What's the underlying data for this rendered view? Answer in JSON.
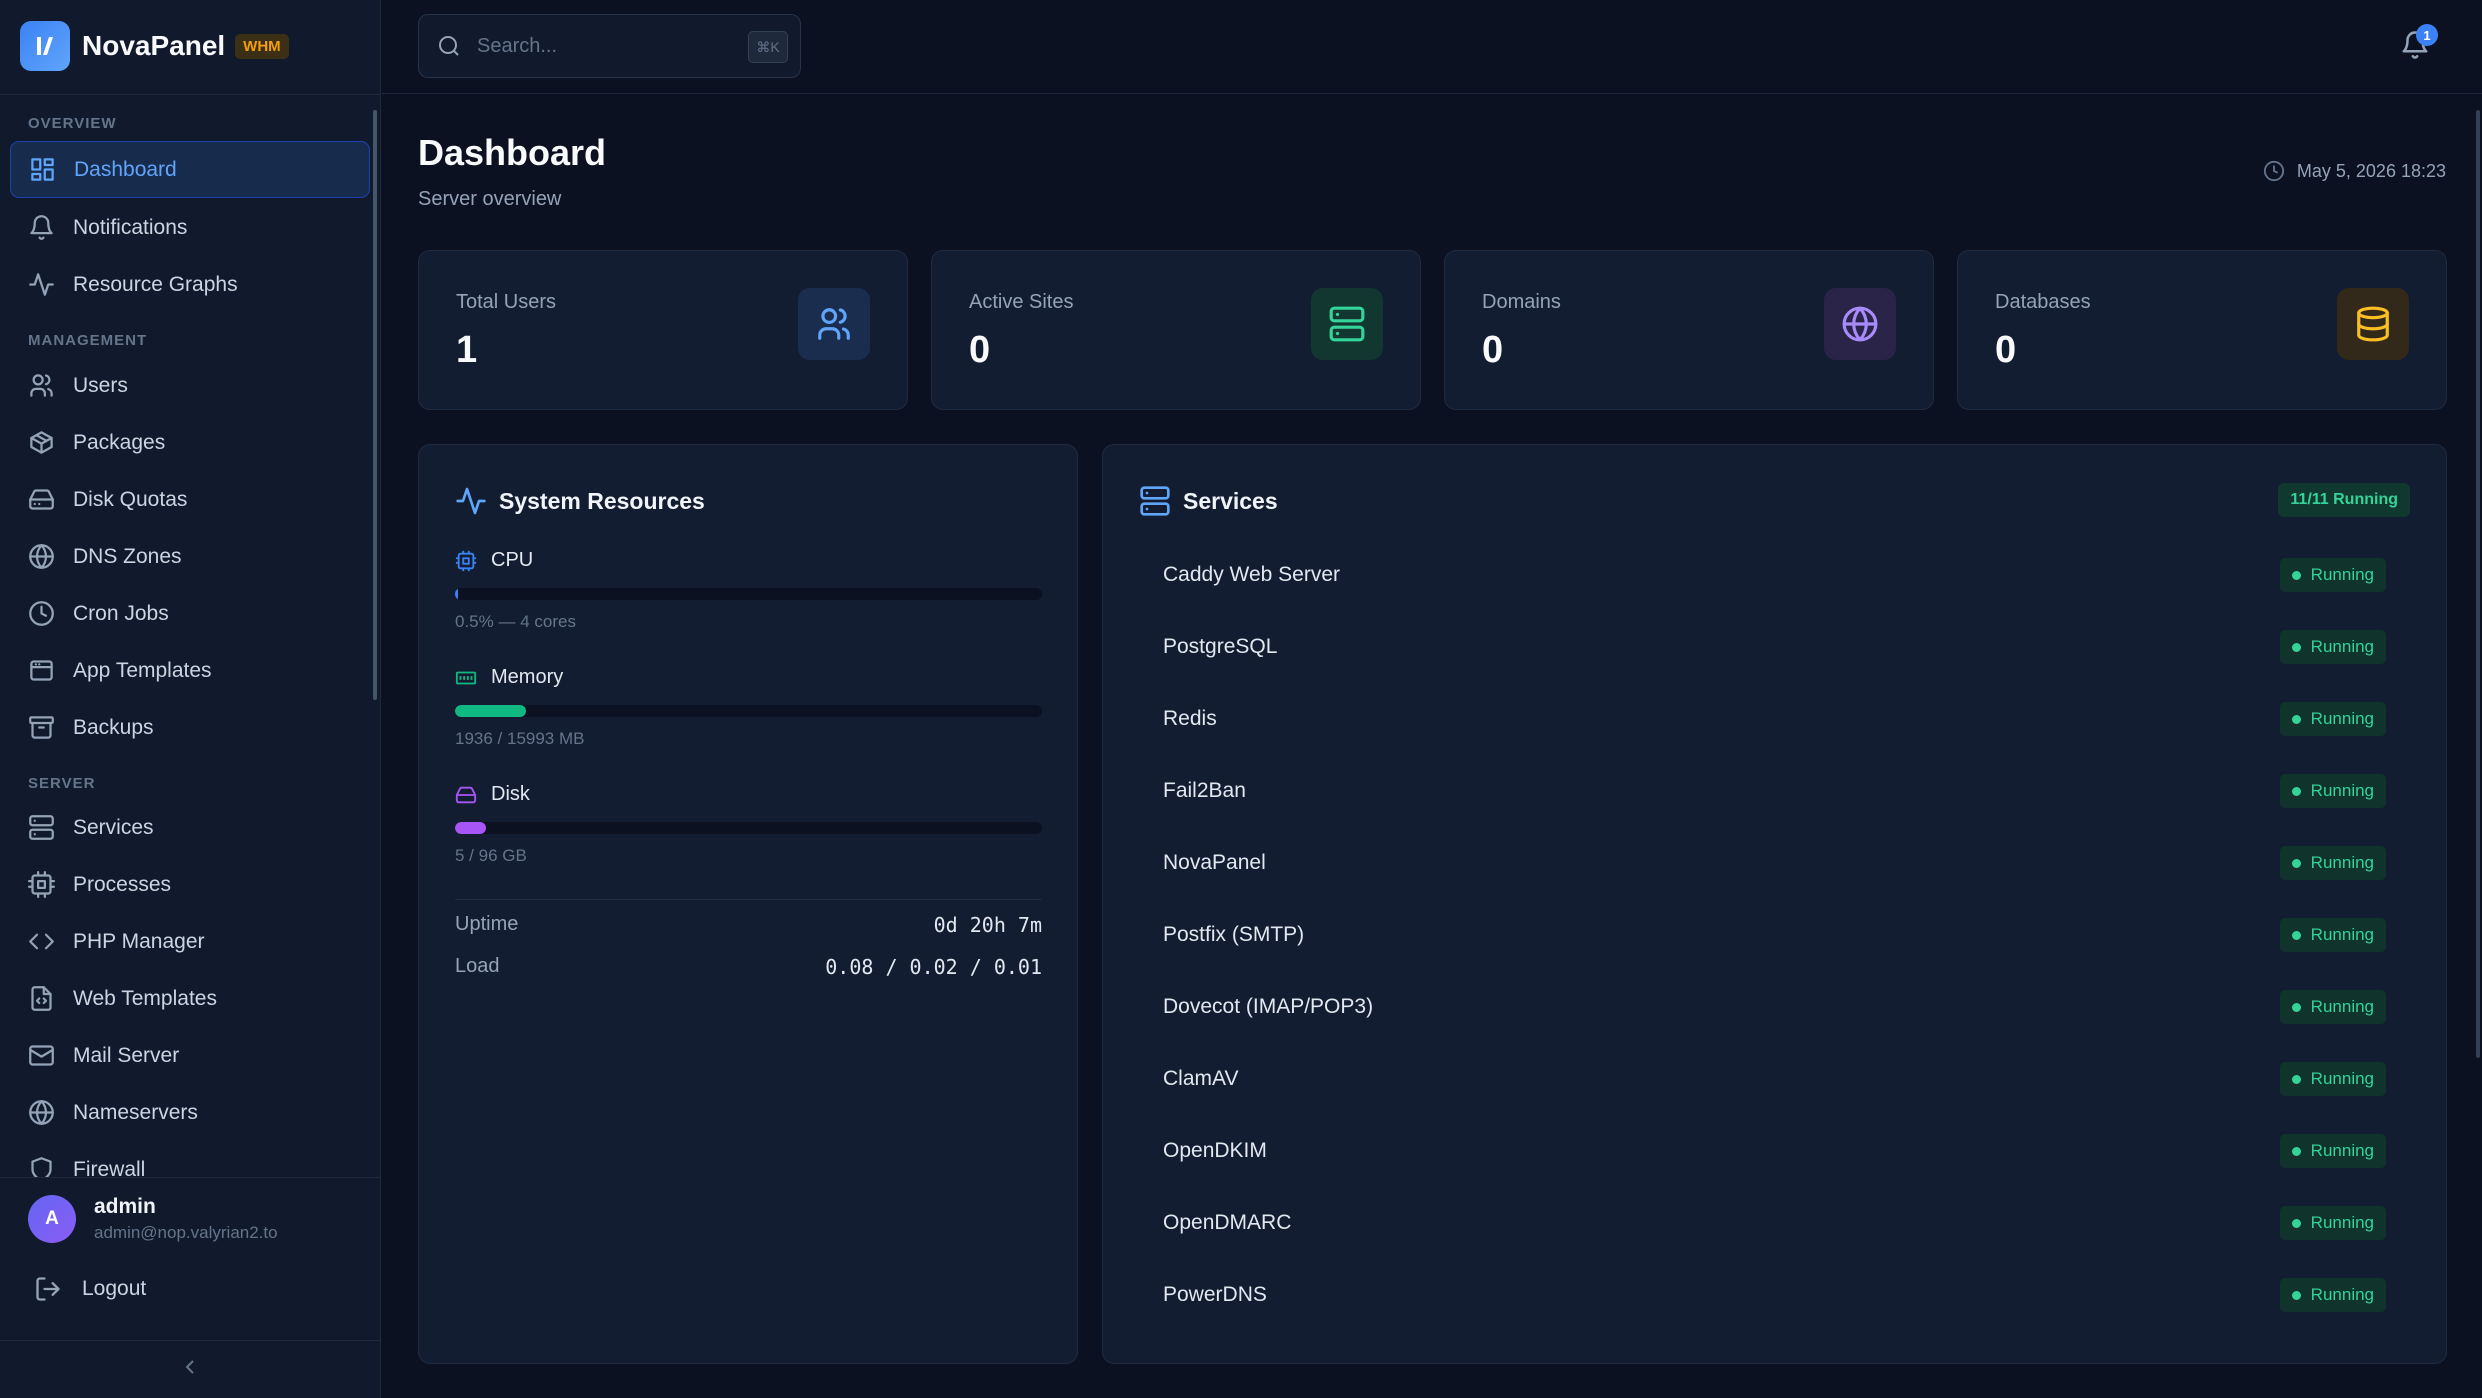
{
  "brand": {
    "name": "NovaPanel",
    "badge": "WHM"
  },
  "search": {
    "placeholder": "Search...",
    "shortcut": "⌘K"
  },
  "notifications": {
    "count": "1"
  },
  "sidebar": {
    "sections": {
      "overview": "OVERVIEW",
      "management": "MANAGEMENT",
      "server": "SERVER"
    },
    "items": [
      {
        "label": "Dashboard",
        "icon": "grid-icon",
        "active": true
      },
      {
        "label": "Notifications",
        "icon": "bell-icon"
      },
      {
        "label": "Resource Graphs",
        "icon": "activity-icon"
      },
      {
        "label": "Users",
        "icon": "users-icon"
      },
      {
        "label": "Packages",
        "icon": "package-icon"
      },
      {
        "label": "Disk Quotas",
        "icon": "hard-drive-icon"
      },
      {
        "label": "DNS Zones",
        "icon": "globe-icon"
      },
      {
        "label": "Cron Jobs",
        "icon": "clock-icon"
      },
      {
        "label": "App Templates",
        "icon": "window-icon"
      },
      {
        "label": "Backups",
        "icon": "archive-icon"
      },
      {
        "label": "Services",
        "icon": "server-icon"
      },
      {
        "label": "Processes",
        "icon": "cpu-icon"
      },
      {
        "label": "PHP Manager",
        "icon": "code-icon"
      },
      {
        "label": "Web Templates",
        "icon": "file-code-icon"
      },
      {
        "label": "Mail Server",
        "icon": "mail-icon"
      },
      {
        "label": "Nameservers",
        "icon": "globe-icon"
      },
      {
        "label": "Firewall",
        "icon": "shield-icon"
      }
    ],
    "user": {
      "initial": "A",
      "name": "admin",
      "email": "admin@nop.valyrian2.to"
    },
    "logout": "Logout"
  },
  "page": {
    "title": "Dashboard",
    "subtitle": "Server overview",
    "timestamp": "May 5, 2026 18:23"
  },
  "stats": [
    {
      "label": "Total Users",
      "value": "1",
      "icon": "users-icon",
      "color": "#60a5fa"
    },
    {
      "label": "Active Sites",
      "value": "0",
      "icon": "server-icon",
      "color": "#34d399"
    },
    {
      "label": "Domains",
      "value": "0",
      "icon": "globe-icon",
      "color": "#a78bfa"
    },
    {
      "label": "Databases",
      "value": "0",
      "icon": "database-icon",
      "color": "#fbbf24"
    }
  ],
  "resources": {
    "title": "System Resources",
    "cpu": {
      "label": "CPU",
      "detail": "0.5% — 4 cores",
      "percent": 0.5,
      "color": "#3b82f6"
    },
    "memory": {
      "label": "Memory",
      "detail": "1936 / 15993 MB",
      "percent": 12.1,
      "color": "#10b981"
    },
    "disk": {
      "label": "Disk",
      "detail": "5 / 96 GB",
      "percent": 5.2,
      "color": "#a855f7"
    },
    "uptime": {
      "label": "Uptime",
      "value": "0d 20h 7m"
    },
    "load": {
      "label": "Load",
      "value": "0.08 / 0.02 / 0.01"
    }
  },
  "services": {
    "title": "Services",
    "summary": "11/11 Running",
    "items": [
      {
        "name": "Caddy Web Server",
        "status": "Running"
      },
      {
        "name": "PostgreSQL",
        "status": "Running"
      },
      {
        "name": "Redis",
        "status": "Running"
      },
      {
        "name": "Fail2Ban",
        "status": "Running"
      },
      {
        "name": "NovaPanel",
        "status": "Running"
      },
      {
        "name": "Postfix (SMTP)",
        "status": "Running"
      },
      {
        "name": "Dovecot (IMAP/POP3)",
        "status": "Running"
      },
      {
        "name": "ClamAV",
        "status": "Running"
      },
      {
        "name": "OpenDKIM",
        "status": "Running"
      },
      {
        "name": "OpenDMARC",
        "status": "Running"
      },
      {
        "name": "PowerDNS",
        "status": "Running"
      }
    ]
  }
}
